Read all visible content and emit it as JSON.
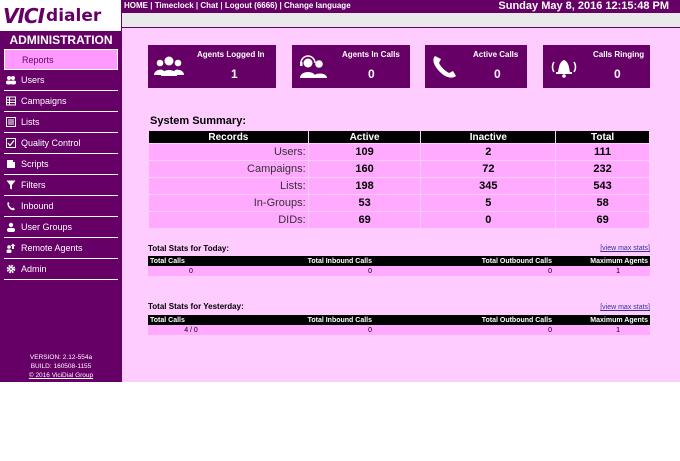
{
  "logo": {
    "vici": "VICI",
    "dialer": "dialer"
  },
  "top_links": {
    "home": "HOME",
    "timeclock": "Timeclock",
    "chat": "Chat",
    "logout": "Logout (6666)",
    "language": "Change language",
    "sep": " | "
  },
  "datetime": "Sunday May 8, 2016 12:15:48 PM",
  "sidebar": {
    "title": "ADMINISTRATION",
    "items": [
      {
        "label": "Reports",
        "icon": "reports-icon"
      },
      {
        "label": "Users",
        "icon": "users-icon"
      },
      {
        "label": "Campaigns",
        "icon": "campaigns-icon"
      },
      {
        "label": "Lists",
        "icon": "lists-icon"
      },
      {
        "label": "Quality Control",
        "icon": "quality-control-icon"
      },
      {
        "label": "Scripts",
        "icon": "scripts-icon"
      },
      {
        "label": "Filters",
        "icon": "filter-icon"
      },
      {
        "label": "Inbound",
        "icon": "inbound-icon"
      },
      {
        "label": "User Groups",
        "icon": "user-groups-icon"
      },
      {
        "label": "Remote Agents",
        "icon": "remote-agents-icon"
      },
      {
        "label": "Admin",
        "icon": "gear-icon"
      }
    ],
    "version": "VERSION: 2.12-554a",
    "build": "BUILD: 160508-1155",
    "copyright": "© 2016 ViciDial Group"
  },
  "cards": [
    {
      "title": "Agents Logged In",
      "value": "1",
      "icon": "agents-icon"
    },
    {
      "title": "Agents In Calls",
      "value": "0",
      "icon": "headset-agents-icon"
    },
    {
      "title": "Active Calls",
      "value": "0",
      "icon": "phone-icon"
    },
    {
      "title": "Calls Ringing",
      "value": "0",
      "icon": "bell-icon"
    }
  ],
  "system_summary": {
    "title": "System Summary:",
    "headers": [
      "Records",
      "Active",
      "Inactive",
      "Total"
    ],
    "rows": [
      {
        "label": "Users:",
        "active": "109",
        "inactive": "2",
        "total": "111"
      },
      {
        "label": "Campaigns:",
        "active": "160",
        "inactive": "72",
        "total": "232"
      },
      {
        "label": "Lists:",
        "active": "198",
        "inactive": "345",
        "total": "543"
      },
      {
        "label": "In-Groups:",
        "active": "53",
        "inactive": "5",
        "total": "58"
      },
      {
        "label": "DIDs:",
        "active": "69",
        "inactive": "0",
        "total": "69"
      }
    ]
  },
  "stats_today": {
    "title": "Total Stats for Today:",
    "link": "[view max stats]",
    "headers": [
      "Total Calls",
      "Total Inbound Calls",
      "Total Outbound Calls",
      "Maximum Agents"
    ],
    "values": [
      "0",
      "0",
      "0",
      "1"
    ]
  },
  "stats_yesterday": {
    "title": "Total Stats for Yesterday:",
    "link": "[view max stats]",
    "headers": [
      "Total Calls",
      "Total Inbound Calls",
      "Total Outbound Calls",
      "Maximum Agents"
    ],
    "values": [
      "4 / 0",
      "0",
      "0",
      "1"
    ]
  }
}
